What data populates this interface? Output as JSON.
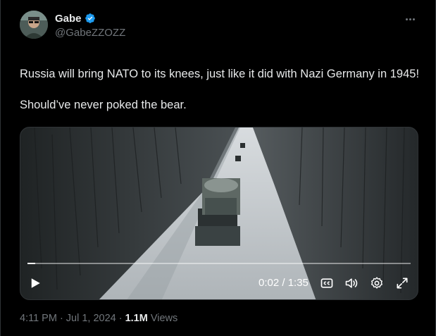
{
  "author": {
    "name": "Gabe",
    "handle": "@GabeZZOZZ",
    "verified": true,
    "avatar_icon": "avatar-photo"
  },
  "tweet": {
    "flag_icon": "russia-flag-icon",
    "line1": "Russia will bring NATO to its knees, just like it did with Nazi Germany in 1945!",
    "line2": "Should’ve never poked the bear."
  },
  "video": {
    "current_time": "0:02",
    "separator": "/",
    "duration": "1:35",
    "time_display": "0:02 / 1:35",
    "progress": 0.02,
    "controls": [
      "play-icon",
      "captions-icon",
      "volume-icon",
      "settings-icon",
      "fullscreen-icon"
    ]
  },
  "meta": {
    "time": "4:11 PM",
    "date": "Jul 1, 2024",
    "separator": "·",
    "views_count": "1.1M",
    "views_label": "Views"
  },
  "colors": {
    "background": "#000000",
    "text_primary": "#e7e9ea",
    "text_secondary": "#71767b",
    "verified_blue": "#1d9bf0",
    "border": "#2f3336"
  }
}
